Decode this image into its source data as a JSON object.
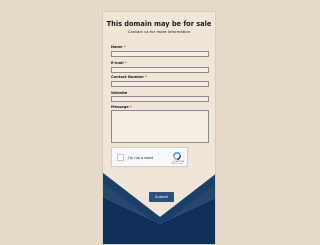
{
  "header": {
    "title": "This domain may be for sale",
    "subtitle": "Contact us for more information"
  },
  "form": {
    "name_label": "Name",
    "email_label": "E-mail",
    "contact_label": "Contact Number",
    "website_label": "Website",
    "message_label": "Message",
    "required_mark": "*",
    "submit_label": "Submit"
  },
  "captcha": {
    "text": "I'm not a robot",
    "brand": "reCAPTCHA",
    "links": "Privacy - Terms"
  },
  "colors": {
    "background": "#e5dac8",
    "card": "#efe6d8",
    "envelope_dark": "#0f2f5c",
    "envelope_mid": "#24466f",
    "submit": "#2d4f7e",
    "required": "#d32f2f"
  },
  "icons": {
    "captcha_logo": "recaptcha-icon"
  }
}
